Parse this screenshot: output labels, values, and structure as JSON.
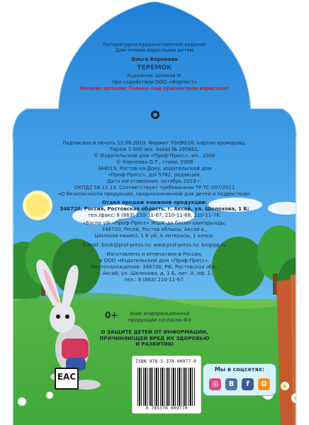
{
  "colophon": {
    "series": "Литературно-художественное издание",
    "audience": "Для чтения взрослыми детям",
    "author": "Ольга Корнеева",
    "title": "ТЕРЕМОК",
    "artist": "Художник Шляхов И.",
    "cooperation": "при содействии ООО «Форпост»",
    "warning": "Мелкие детали! Только под присмотром взрослых!",
    "print": "Подписано в печать 12.09.2019. Формат 70х90/16, картон хромэрзац.",
    "run": "Тираж 5 000 экз. Заказ № 195661.",
    "copy1": "© Издательский дом «Проф-Пресс», ил., 2008",
    "copy2": "© Корнеева О.Т., стихи, 2008",
    "pubaddr": "344019, Ростов-на-Дону, издательский дом",
    "pubaddr2": "«Проф-Пресс», д/я 5782, редакция.",
    "date": "Дата изготовления: октябрь 2019 г.",
    "okpd": "ОКПД2 58.11.13. Соответствует требованиям ТР ТС 007/2011",
    "safety": "«О безопасности продукции, предназначенной для детей и подростков»",
    "sales_title": "Отдел продаж книжной продукции:",
    "sales_addr": "346720, Россия, Ростовская область, г. Аксай, ул. Шолохова, 1 Б;",
    "phone": "тел./факс: 8 (863) 210-11-67, 210-11-68, 210-11-76.",
    "kaz1": "«Баспа үйі «Проф-Пресс» ЖШҚ-да басып шығарылды,",
    "kaz2": "346720, Ресей, Ростов облысы, Аксай қ.,",
    "kaz3": "Шолохов көшесі, 1 Б үй, А литерасы, 1 кеңсе.",
    "email": "E-mail: book@prof-press.ru; www.prof-press.ru; knigipp.ru",
    "made1": "Изготовлено и отпечатано в России,",
    "made2": "в ООО «Издательский дом «Проф-Пресс».",
    "loc1": "Местонахождение: 346720, РФ, Ростовская обл.,",
    "loc2": "г. Аксай, ул. Шолохова, д. 1 Б, лит. А, оф. 1;",
    "loc3": "тел.: 8 (863) 210-11-67."
  },
  "age": {
    "mark": "0+",
    "note1": "Знак информационной",
    "note2": "продукции согласно ФЗ"
  },
  "law": {
    "line1": "О ЗАЩИТЕ ДЕТЕЙ ОТ ИНФОРМАЦИИ,",
    "line2": "ПРИЧИНЯЮЩЕЙ ВРЕД ИХ ЗДОРОВЬЮ",
    "line3": "И РАЗВИТИЮ"
  },
  "isbn": {
    "text": "ISBN 978-5-378-00977-0",
    "barcode_digits": "9 785378 009770"
  },
  "eac": "ЕАС",
  "social": {
    "title": "Мы в соцсетях:",
    "icons": [
      "instagram-icon",
      "vk-icon",
      "facebook-icon",
      "odnoklassniki-icon"
    ]
  },
  "colors": {
    "sky": "#2f8de0",
    "grass": "#3ea63a"
  }
}
